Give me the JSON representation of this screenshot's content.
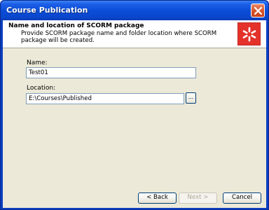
{
  "window": {
    "title": "Course Publication"
  },
  "header": {
    "title": "Name and location of SCORM package",
    "description": "Provide SCORM package name and folder location where SCORM package will be created."
  },
  "form": {
    "name_label": "Name:",
    "name_value": "Test01",
    "location_label": "Location:",
    "location_value": "E:\\Courses\\Published",
    "browse_label": "..."
  },
  "buttons": {
    "back": "< Back",
    "next": "Next >",
    "cancel": "Cancel"
  },
  "icons": {
    "close": "close-icon",
    "logo": "asterisk-logo"
  },
  "colors": {
    "titlebar": "#0b4dd8",
    "close": "#d9562c",
    "logo": "#e4322b",
    "dialog_bg": "#ece9d8"
  }
}
